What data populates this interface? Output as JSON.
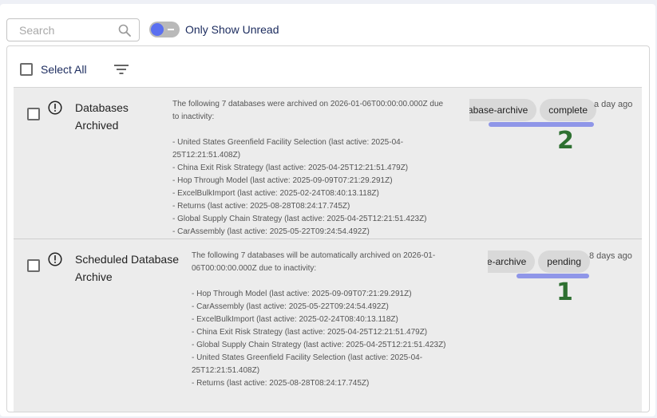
{
  "search": {
    "placeholder": "Search"
  },
  "toggle": {
    "label": "Only Show Unread"
  },
  "toolbar": {
    "select_all_label": "Select All"
  },
  "notifications": [
    {
      "title": "Databases Archived",
      "intro": "The following 7 databases were archived on 2026-01-06T00:00:00.000Z due to inactivity:",
      "lines": [
        "- United States Greenfield Facility Selection (last active: 2025-04-25T12:21:51.408Z)",
        "- China Exit Risk Strategy (last active: 2025-04-25T12:21:51.479Z)",
        "- Hop Through Model (last active: 2025-09-09T07:21:29.291Z)",
        "- ExcelBulkImport (last active: 2025-02-24T08:40:13.118Z)",
        "- Returns (last active: 2025-08-28T08:24:17.745Z)",
        "- Global Supply Chain Strategy (last active: 2025-04-25T12:21:51.423Z)",
        "- CarAssembly (last active: 2025-05-22T09:24:54.492Z)"
      ],
      "tag_type": "abase-archive",
      "tag_status": "complete",
      "time": "a day ago",
      "marker": "2"
    },
    {
      "title": "Scheduled Database Archive",
      "intro": "The following 7 databases will be automatically archived on 2026-01-06T00:00:00.000Z due to inactivity:",
      "lines": [
        "- Hop Through Model (last active: 2025-09-09T07:21:29.291Z)",
        "- CarAssembly (last active: 2025-05-22T09:24:54.492Z)",
        "- ExcelBulkImport (last active: 2025-02-24T08:40:13.118Z)",
        "- China Exit Risk Strategy (last active: 2025-04-25T12:21:51.479Z)",
        "- Global Supply Chain Strategy (last active: 2025-04-25T12:21:51.423Z)",
        "- United States Greenfield Facility Selection (last active: 2025-04-25T12:21:51.408Z)",
        "- Returns (last active: 2025-08-28T08:24:17.745Z)"
      ],
      "tag_type": "se-archive",
      "tag_status": "pending",
      "time": "8 days ago",
      "marker": "1"
    }
  ],
  "colors": {
    "accent": "#5a6ff0",
    "highlight_bar": "#8f96e8",
    "marker": "#2e7031",
    "item_bg": "#ececec"
  },
  "icons": {
    "search": "search-icon",
    "filter": "filter-icon",
    "alert": "alert-circle-icon"
  }
}
